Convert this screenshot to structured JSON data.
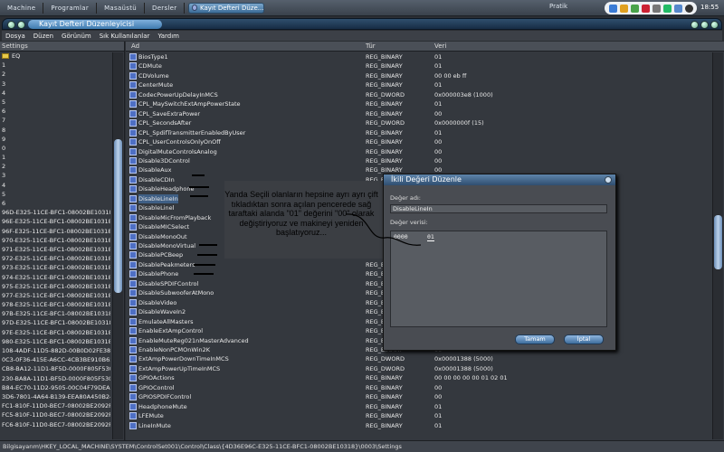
{
  "taskbar": {
    "items": [
      "Machine",
      "Programlar",
      "Masaüstü",
      "Dersler"
    ],
    "window_title": "Kayıt Defteri Düze...",
    "right_label": "Pratik",
    "clock": "18:55"
  },
  "window": {
    "title": "Kayıt Defteri Düzenleyicisi"
  },
  "menu": [
    "Dosya",
    "Düzen",
    "Görünüm",
    "Sık Kullanılanlar",
    "Yardım"
  ],
  "left_pane": {
    "header": "Settings",
    "folder": "EQ",
    "rows": [
      "1",
      "2",
      "3",
      "4",
      "5",
      "6",
      "7",
      "8",
      "9",
      "0",
      "1",
      "2",
      "3",
      "4",
      "5",
      "6",
      "96D-E325-11CE-BFC1-08002BE10318}",
      "96E-E325-11CE-BFC1-08002BE10318}",
      "96F-E325-11CE-BFC1-08002BE10318}",
      "970-E325-11CE-BFC1-08002BE10318}",
      "971-E325-11CE-BFC1-08002BE10318}",
      "972-E325-11CE-BFC1-08002BE10318}",
      "973-E325-11CE-BFC1-08002BE10318}",
      "974-E325-11CE-BFC1-08002BE10318}",
      "975-E325-11CE-BFC1-08002BE10318}",
      "977-E325-11CE-BFC1-08002BE10318}",
      "978-E325-11CE-BFC1-08002BE10318}",
      "97B-E325-11CE-BFC1-08002BE10318}",
      "97D-E325-11CE-BFC1-08002BE10318}",
      "97E-E325-11CE-BFC1-08002BE10318}",
      "980-E325-11CE-BFC1-08002BE10318}",
      "108-4ADF-11D5-882D-00B0D02FE381}",
      "0C3-0F36-415E-A6CC-4CB3BE910B65}",
      "CB8-BA12-11D1-BF5D-0000F805F530}",
      "230-BA8A-11D1-BF5D-0000F805F530}",
      "B84-EC70-11D2-9505-00C04F79DEAF}",
      "3D6-7801-4A64-B139-EEA80A450B24}",
      "FC1-810F-11D0-BEC7-08002BE2092F}",
      "FC5-810F-11D0-BEC7-08002BE2092F}",
      "FC6-810F-11D0-BEC7-08002BE2092F}"
    ]
  },
  "columns": {
    "name": "Ad",
    "type": "Tür",
    "value": "Veri"
  },
  "entries": [
    {
      "name": "BiosType1",
      "type": "REG_BINARY",
      "value": "01"
    },
    {
      "name": "CDMute",
      "type": "REG_BINARY",
      "value": "01"
    },
    {
      "name": "CDVolume",
      "type": "REG_BINARY",
      "value": "00 00 eb ff"
    },
    {
      "name": "CenterMute",
      "type": "REG_BINARY",
      "value": "01"
    },
    {
      "name": "CodecPowerUpDelayInMCS",
      "type": "REG_DWORD",
      "value": "0x000003e8 (1000)"
    },
    {
      "name": "CPL_MaySwitchExtAmpPowerState",
      "type": "REG_BINARY",
      "value": "01"
    },
    {
      "name": "CPL_SaveExtraPower",
      "type": "REG_BINARY",
      "value": "00"
    },
    {
      "name": "CPL_SecondsAfter",
      "type": "REG_DWORD",
      "value": "0x0000000f (15)"
    },
    {
      "name": "CPL_SpdifTransmitterEnabledByUser",
      "type": "REG_BINARY",
      "value": "01"
    },
    {
      "name": "CPL_UserControlsOnlyOnOff",
      "type": "REG_BINARY",
      "value": "00"
    },
    {
      "name": "DigitalMuteControlsAnalog",
      "type": "REG_BINARY",
      "value": "00"
    },
    {
      "name": "Disable3DControl",
      "type": "REG_BINARY",
      "value": "00"
    },
    {
      "name": "DisableAux",
      "type": "REG_BINARY",
      "value": "00"
    },
    {
      "name": "DisableCDIn",
      "type": "REG_BINARY",
      "value": "00"
    },
    {
      "name": "DisableHeadphone",
      "type": "REG_BINARY",
      "value": "00"
    },
    {
      "name": "DisableLineIn",
      "type": "REG_BINARY",
      "value": "00"
    },
    {
      "name": "DisableLinel",
      "type": "REG_BINARY",
      "value": "00"
    },
    {
      "name": "DisableMicFromPlayback",
      "type": "REG_BINARY",
      "value": "00"
    },
    {
      "name": "DisableMICSelect",
      "type": "REG_BINARY",
      "value": "00"
    },
    {
      "name": "DisableMonoOut",
      "type": "REG_BINARY",
      "value": "00"
    },
    {
      "name": "DisableMonoVirtual",
      "type": "REG_BINARY",
      "value": "00"
    },
    {
      "name": "DisablePCBeep",
      "type": "REG_BINARY",
      "value": "00"
    },
    {
      "name": "DisablePeakmeters",
      "type": "REG_BINARY",
      "value": "00"
    },
    {
      "name": "DisablePhone",
      "type": "REG_BINARY",
      "value": "00"
    },
    {
      "name": "DisableSPDIFControl",
      "type": "REG_BINARY",
      "value": "00"
    },
    {
      "name": "DisableSubwooferAtMono",
      "type": "REG_BINARY",
      "value": "00"
    },
    {
      "name": "DisableVideo",
      "type": "REG_BINARY",
      "value": "00"
    },
    {
      "name": "DisableWaveIn2",
      "type": "REG_BINARY",
      "value": "00"
    },
    {
      "name": "EmulateAllMasters",
      "type": "REG_BINARY",
      "value": "00"
    },
    {
      "name": "EnableExtAmpControl",
      "type": "REG_BINARY",
      "value": "00"
    },
    {
      "name": "EnableMuteReg021nMasterAdvanced",
      "type": "REG_BINARY",
      "value": "00"
    },
    {
      "name": "EnableNonPCMOnWin2K",
      "type": "REG_BINARY",
      "value": "00"
    },
    {
      "name": "ExtAmpPowerDownTimeInMCS",
      "type": "REG_DWORD",
      "value": "0x00001388 (5000)"
    },
    {
      "name": "ExtAmpPowerUpTimeInMCS",
      "type": "REG_DWORD",
      "value": "0x00001388 (5000)"
    },
    {
      "name": "GPIOActions",
      "type": "REG_BINARY",
      "value": "00 00 00 00 00 01 02 01"
    },
    {
      "name": "GPIOControl",
      "type": "REG_BINARY",
      "value": "00"
    },
    {
      "name": "GPIOSPDIFControl",
      "type": "REG_BINARY",
      "value": "00"
    },
    {
      "name": "HeadphoneMute",
      "type": "REG_BINARY",
      "value": "01"
    },
    {
      "name": "LFEMute",
      "type": "REG_BINARY",
      "value": "01"
    },
    {
      "name": "LineInMute",
      "type": "REG_BINARY",
      "value": "01"
    }
  ],
  "selected_index": 15,
  "status_path": "Bilgisayarım\\HKEY_LOCAL_MACHINE\\SYSTEM\\ControlSet001\\Control\\Class\\{4D36E96C-E325-11CE-BFC1-08002BE10318}\\0003\\Settings",
  "dialog": {
    "title": "İkili Değeri Düzenle",
    "name_label": "Değer adı:",
    "name_value": "DisableLineIn",
    "data_label": "Değer verisi:",
    "data_offset": "0000",
    "data_bytes": "01",
    "ok": "Tamam",
    "cancel": "İptal"
  },
  "annotation": "Yanda Seçili olanların hepsine ayrı ayrı çift tıkladıktan sonra açılan pencerede sağ taraftaki alanda \"01\" değerini \"00\" olarak değiştiriyoruz ve makineyi yeniden başlatıyoruz...",
  "colors": {
    "accent": "#3f7bb0",
    "background": "#34383e"
  }
}
